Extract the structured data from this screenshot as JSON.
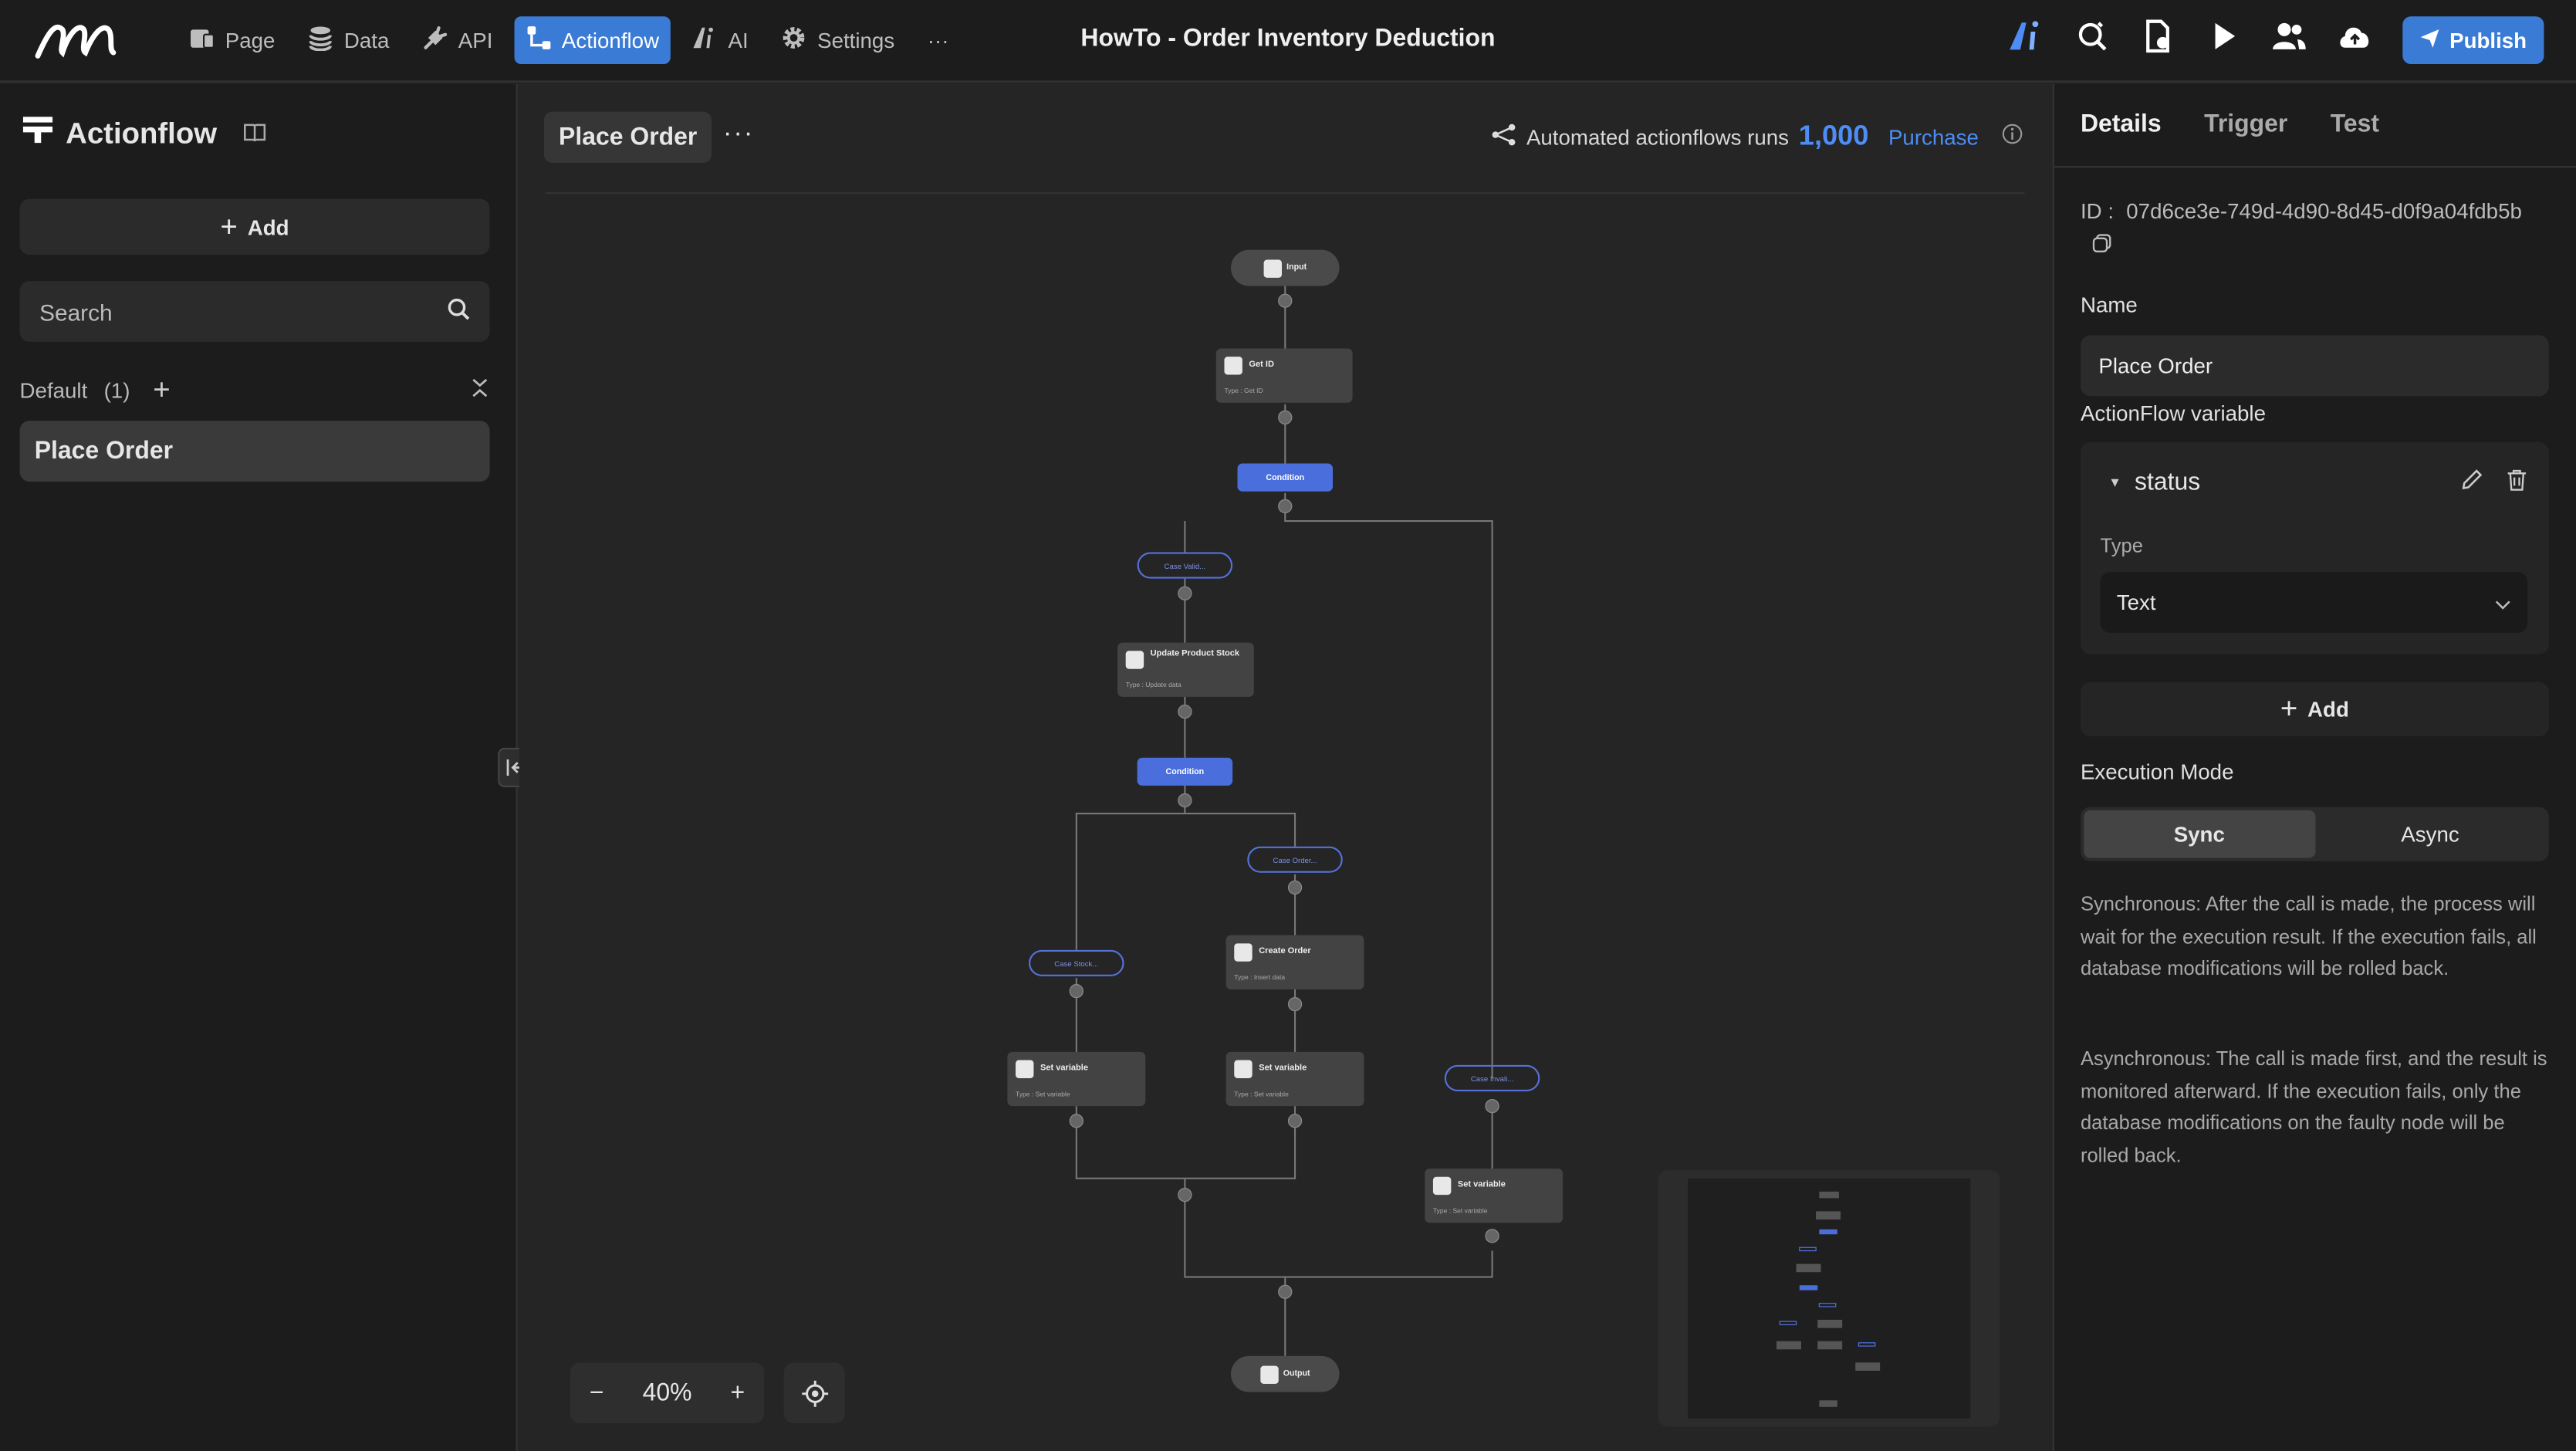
{
  "nav": {
    "items": [
      {
        "label": "Page",
        "icon": "page-icon"
      },
      {
        "label": "Data",
        "icon": "database-icon"
      },
      {
        "label": "API",
        "icon": "plug-icon"
      },
      {
        "label": "Actionflow",
        "icon": "flow-icon"
      },
      {
        "label": "AI",
        "icon": "ai-icon"
      },
      {
        "label": "Settings",
        "icon": "gear-icon"
      }
    ],
    "more": "···",
    "title": "HowTo - Order Inventory Deduction",
    "publish": "Publish",
    "accent": "#3a7bd5"
  },
  "sidebar": {
    "title": "Actionflow",
    "add": "Add",
    "search_placeholder": "Search",
    "group_name": "Default",
    "group_count": "(1)",
    "flows": [
      "Place Order"
    ]
  },
  "canvas": {
    "tab": "Place Order",
    "more": "···",
    "runs_label": "Automated actionflows runs",
    "runs_count": "1,000",
    "purchase": "Purchase",
    "zoom": "40%",
    "nodes": {
      "input": "Input",
      "get_id_title": "Get ID",
      "get_id_type": "Type : Get ID",
      "condition1": "Condition",
      "case_valid": "Case Valid...",
      "update_title": "Update Product Stock",
      "update_type": "Type : Update data",
      "condition2": "Condition",
      "case_order": "Case Order...",
      "case_stock": "Case Stock...",
      "case_invalid": "Case Invali...",
      "create_title": "Create Order",
      "create_type": "Type : Insert data",
      "setvar_title": "Set variable",
      "setvar_type": "Type : Set variable",
      "output": "Output"
    }
  },
  "panel": {
    "tabs": [
      "Details",
      "Trigger",
      "Test"
    ],
    "id_label": "ID :",
    "id_value": "07d6ce3e-749d-4d90-8d45-d0f9a04fdb5b",
    "name_label": "Name",
    "name_value": "Place Order",
    "variable_label": "ActionFlow variable",
    "var_name": "status",
    "type_label": "Type",
    "type_value": "Text",
    "add": "Add",
    "exec_label": "Execution Mode",
    "sync": "Sync",
    "async": "Async",
    "sync_desc": "Synchronous: After the call is made, the process will wait for the execution result. If the execution fails, all database modifications will be rolled back.",
    "async_desc": "Asynchronous: The call is made first, and the result is monitored afterward. If the execution fails, only the database modifications on the faulty node will be rolled back."
  }
}
